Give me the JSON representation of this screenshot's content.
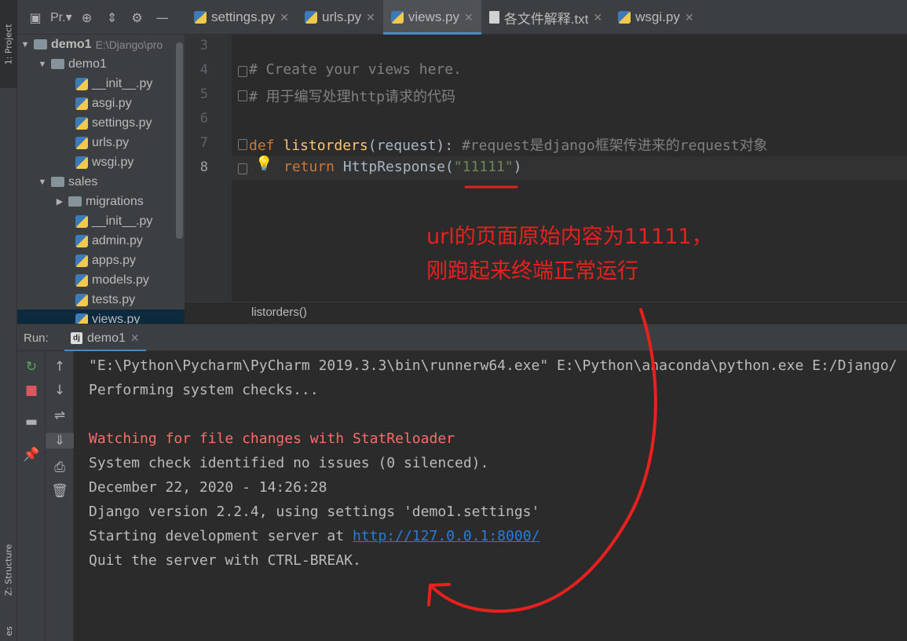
{
  "sidebar": {
    "project_tab": "1: Project",
    "structure_tab": "Z: Structure",
    "favorites_tab": "es"
  },
  "project_panel": {
    "label": "Pr.▾"
  },
  "tabs": [
    {
      "label": "settings.py",
      "icon": "python-file-icon",
      "active": false
    },
    {
      "label": "urls.py",
      "icon": "python-file-icon",
      "active": false
    },
    {
      "label": "views.py",
      "icon": "python-file-icon",
      "active": true
    },
    {
      "label": "各文件解释.txt",
      "icon": "text-file-icon",
      "active": false
    },
    {
      "label": "wsgi.py",
      "icon": "python-file-icon",
      "active": false
    }
  ],
  "project_tree": {
    "root_name": "demo1",
    "root_path": "E:\\Django\\pro",
    "items": [
      {
        "label": "demo1"
      },
      {
        "label": "__init__.py"
      },
      {
        "label": "asgi.py"
      },
      {
        "label": "settings.py"
      },
      {
        "label": "urls.py"
      },
      {
        "label": "wsgi.py"
      },
      {
        "label": "sales"
      },
      {
        "label": "migrations"
      },
      {
        "label": "__init__.py"
      },
      {
        "label": "admin.py"
      },
      {
        "label": "apps.py"
      },
      {
        "label": "models.py"
      },
      {
        "label": "tests.py"
      },
      {
        "label": "views.py"
      }
    ]
  },
  "editor": {
    "line_numbers": [
      "3",
      "4",
      "5",
      "6",
      "7",
      "8"
    ],
    "line4": "# Create your views here.",
    "line5": "# 用于编写处理http请求的代码",
    "line7": {
      "kw": "def",
      "fn": "listorders",
      "params": "(request):",
      "comment": "#request是django框架传进来的request对象"
    },
    "line8": {
      "kw": "return",
      "call": "HttpResponse(",
      "str": "\"11111\"",
      "close": ")"
    },
    "breadcrumb": "listorders()"
  },
  "run": {
    "label": "Run:",
    "tab_label": "demo1",
    "console": [
      "\"E:\\Python\\Pycharm\\PyCharm 2019.3.3\\bin\\runnerw64.exe\" E:\\Python\\anaconda\\python.exe E:/Django/",
      "Performing system checks...",
      "Watching for file changes with StatReloader",
      "System check identified no issues (0 silenced).",
      "December 22, 2020 - 14:26:28",
      "Django version 2.2.4, using settings 'demo1.settings'",
      "Starting development server at ",
      "Quit the server with CTRL-BREAK."
    ],
    "server_url": "http://127.0.0.1:8000/"
  },
  "annotation": {
    "line1": "url的页面原始内容为11111，",
    "line2": "刚跑起来终端正常运行",
    "color": "#e8211e"
  },
  "colors": {
    "keyword": "#cc7832",
    "function": "#ffc66d",
    "string": "#6a8759",
    "comment": "#808080",
    "error_text": "#ff6b68",
    "link": "#287bde",
    "active_tab_underline": "#4a88c7"
  }
}
